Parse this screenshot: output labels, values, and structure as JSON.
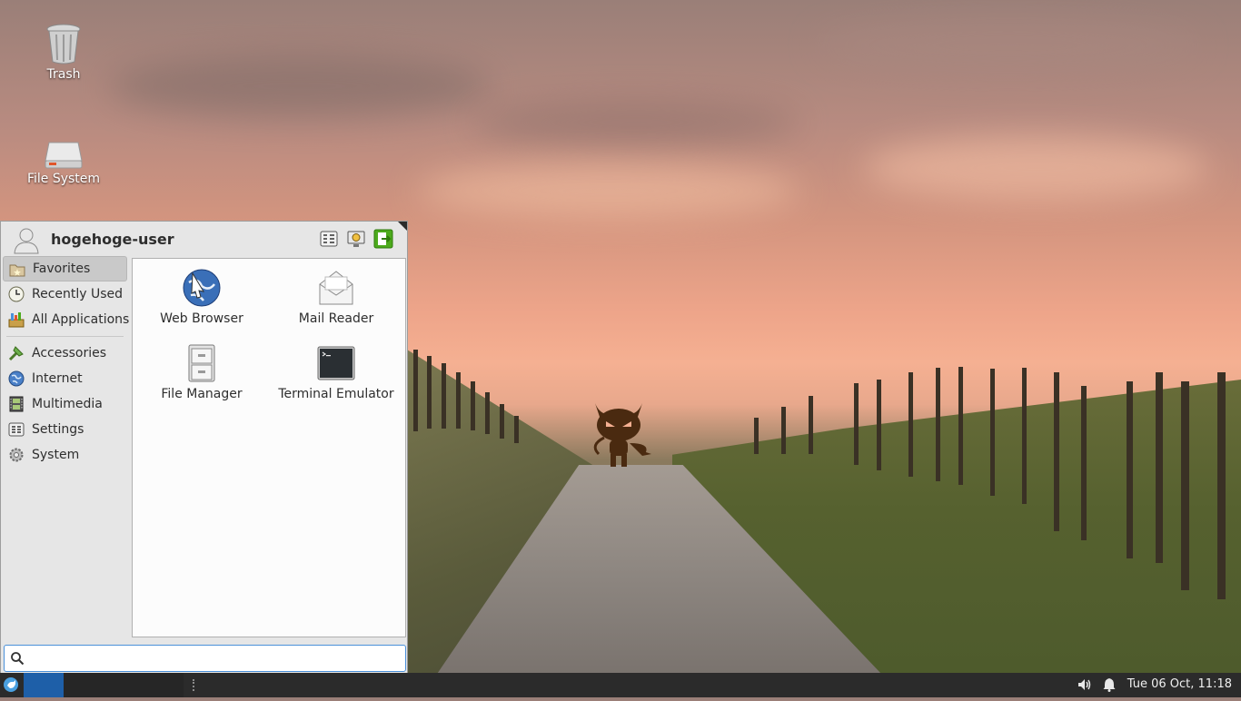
{
  "desktop": {
    "icons": [
      {
        "label": "Trash"
      },
      {
        "label": "File System"
      }
    ]
  },
  "menu": {
    "username": "hogehoge-user",
    "header_buttons": [
      "settings-manager-icon",
      "lock-screen-icon",
      "log-out-icon"
    ],
    "categories": [
      {
        "label": "Favorites",
        "icon": "star-folder-icon",
        "active": true
      },
      {
        "label": "Recently Used",
        "icon": "clock-icon"
      },
      {
        "label": "All Applications",
        "icon": "all-apps-icon"
      },
      {
        "label": "Accessories",
        "icon": "accessories-icon"
      },
      {
        "label": "Internet",
        "icon": "globe-icon"
      },
      {
        "label": "Multimedia",
        "icon": "film-icon"
      },
      {
        "label": "Settings",
        "icon": "settings-icon"
      },
      {
        "label": "System",
        "icon": "gear-icon"
      }
    ],
    "apps": [
      {
        "label": "Web Browser",
        "icon": "web-browser-icon"
      },
      {
        "label": "Mail Reader",
        "icon": "mail-reader-icon"
      },
      {
        "label": "File Manager",
        "icon": "file-cabinet-icon"
      },
      {
        "label": "Terminal Emulator",
        "icon": "terminal-icon"
      }
    ],
    "search": {
      "value": "",
      "placeholder": ""
    }
  },
  "panel": {
    "clock": "Tue 06 Oct, 11:18"
  },
  "colors": {
    "panel_bg": "#2b2b2b",
    "active_workspace": "#1e5fa8",
    "search_border": "#4a90d9"
  }
}
